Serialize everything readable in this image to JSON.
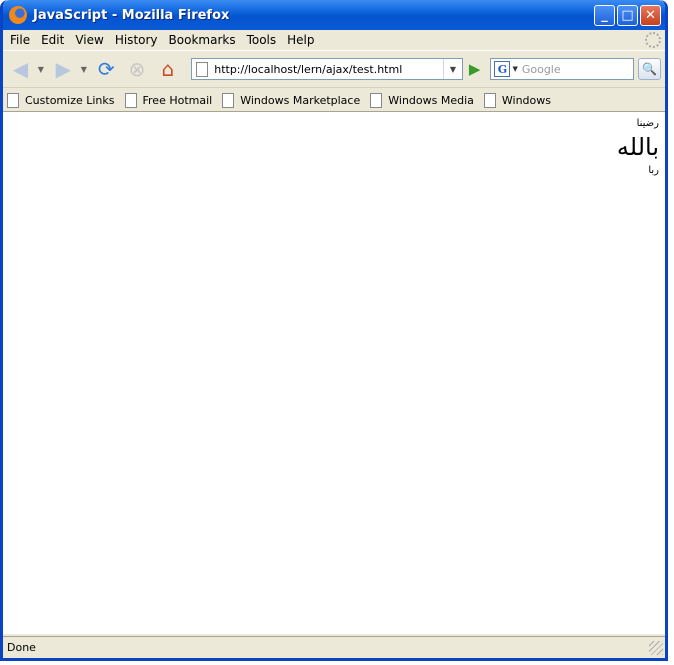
{
  "window": {
    "title": "JavaScript - Mozilla Firefox"
  },
  "menu": [
    "File",
    "Edit",
    "View",
    "History",
    "Bookmarks",
    "Tools",
    "Help"
  ],
  "navbar": {
    "url": "http://localhost/lern/ajax/test.html",
    "search_placeholder": "Google"
  },
  "bookmarks": [
    "Customize Links",
    "Free Hotmail",
    "Windows Marketplace",
    "Windows Media",
    "Windows"
  ],
  "content": {
    "line1": "رضينا",
    "line2": "بالله",
    "line3": "ربا"
  },
  "status": {
    "text": "Done"
  }
}
